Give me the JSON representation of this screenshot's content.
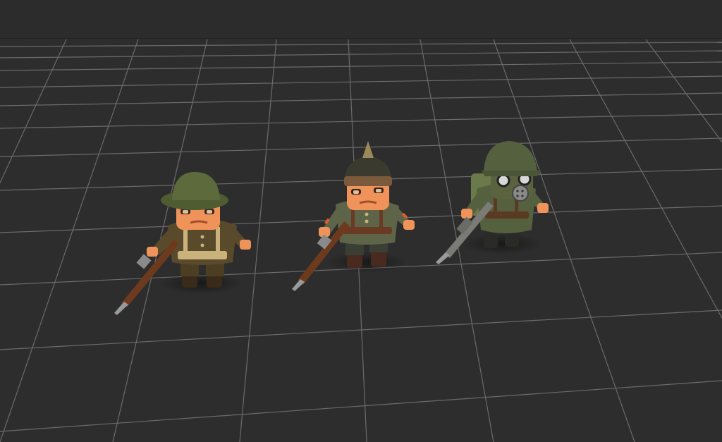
{
  "scene": {
    "background_color": "#2b2b2b",
    "grid_color": "#6b6b6b",
    "topbar_color": "#2c2c2c"
  },
  "characters": [
    {
      "name": "british-soldier",
      "helmet": "brodie-helmet",
      "uniform_color": "#5a4a2c",
      "helmet_color": "#5c6a3c",
      "skin_color": "#f0935a",
      "weapon": "rifle-icon"
    },
    {
      "name": "german-pickelhaube-soldier",
      "helmet": "pickelhaube-helmet",
      "uniform_color": "#5d6448",
      "helmet_color": "#3a3a2e",
      "skin_color": "#f0935a",
      "weapon": "rifle-icon"
    },
    {
      "name": "german-gas-mask-soldier",
      "helmet": "stahlhelm-helmet",
      "uniform_color": "#55603f",
      "helmet_color": "#55603f",
      "skin_color": "#f0935a",
      "weapon": "rifle-icon"
    }
  ]
}
